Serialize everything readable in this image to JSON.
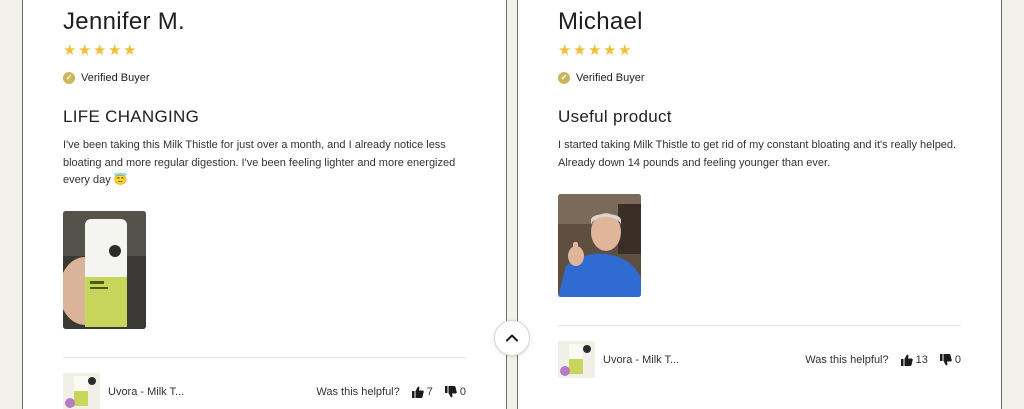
{
  "colors": {
    "star": "#f1bf3b",
    "verified": "#c9b65d",
    "card_border": "#6d6e64",
    "page_bg": "#f2f1ea"
  },
  "reviews": [
    {
      "name": "Jennifer M.",
      "rating": 5,
      "verified_label": "Verified Buyer",
      "title": "LIFE CHANGING",
      "body": "I've been taking this Milk Thistle for just over a month, and I already notice less bloating and more regular digestion. I've been feeling lighter and more energized every day 😇",
      "product_name": "Uvora - Milk T...",
      "helpful_label": "Was this helpful?",
      "upvotes": "7",
      "downvotes": "0"
    },
    {
      "name": "Michael",
      "rating": 5,
      "verified_label": "Verified Buyer",
      "title": "Useful product",
      "body": "I started taking Milk Thistle to get rid of my constant bloating and it's really helped. Already down 14 pounds and feeling younger than ever.",
      "product_name": "Uvora - Milk T...",
      "helpful_label": "Was this helpful?",
      "upvotes": "13",
      "downvotes": "0"
    }
  ],
  "icons": {
    "verified": "check-circle-icon",
    "upvote": "thumbs-up-icon",
    "downvote": "thumbs-down-icon",
    "scroll_top": "chevron-up-icon"
  }
}
